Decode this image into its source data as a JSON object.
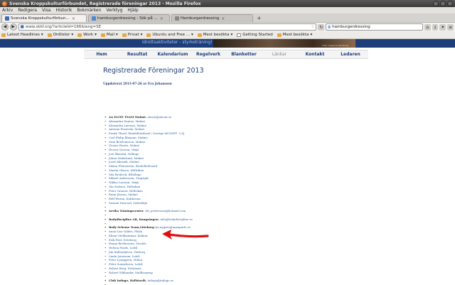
{
  "window": {
    "title": "Svenska Kroppskulturförbundet, Registrerade föreningar 2013 - Mozilla Firefox",
    "left_label": "Erik Frid"
  },
  "menubar": [
    "Arkiv",
    "Redigera",
    "Visa",
    "Historik",
    "Bokmärken",
    "Verktyg",
    "Hjälp"
  ],
  "tabs": [
    {
      "label": "Svenska Kroppskulturförbun...",
      "active": true
    },
    {
      "label": "hamburgerdressing - Sök på ...",
      "active": false
    },
    {
      "label": "Hamburgerdressing",
      "active": false
    }
  ],
  "navigation": {
    "url": "www.skkf.org/?articleId=166&lang=SE",
    "search_value": "hamburgerdressing"
  },
  "bookmarks": [
    "Latest Headlines",
    "Ordlistor",
    "Work",
    "Mail",
    "Privat",
    "Ubuntu and Free ...",
    "Mest besökta",
    "Getting Started",
    "Mest besökta"
  ],
  "site": {
    "banner_sub": "Idrottsaktiviteter - styrketräning!",
    "photo_caption": "Foto: Susanne Sandberg",
    "nav": [
      "Hem",
      "Resultat",
      "Kalendarium",
      "Regelverk",
      "Blanketter",
      "Länkar",
      "Kontakt",
      "Ledaren"
    ],
    "current_nav": "Länkar",
    "page_title": "Registrerade Föreningar 2013",
    "updated": "Uppdaterat 2013-07-26 av Eva Johansson"
  },
  "associations": [
    {
      "type": "head",
      "text": "AA ELITE TEAM Malmö.",
      "email": "aleaut@aleaut.se"
    },
    {
      "type": "person",
      "text": "Alexandra Danius, Malmö"
    },
    {
      "type": "person",
      "text": "Alexandra Larsson, Malmö"
    },
    {
      "type": "person",
      "text": "Antonia Ponevski, Malmö"
    },
    {
      "type": "person",
      "text": "Frank Thord, Rundelbordsnel / Sverige till DSFF +/3J"
    },
    {
      "type": "person",
      "text": "Carl-Philip Åhmann, Malmö"
    },
    {
      "type": "person",
      "text": "Gina Bertlomsson, Malmö"
    },
    {
      "type": "person",
      "text": "Gustav Rosén, Malmö"
    },
    {
      "type": "person",
      "text": "Hector Qusson, Växjö"
    },
    {
      "type": "person",
      "text": "Joel Åkesdal, Vellinge"
    },
    {
      "type": "person",
      "text": "Johan Söderlund, Malmö"
    },
    {
      "type": "person",
      "text": "Josef Aliozadi, Malmö"
    },
    {
      "type": "person",
      "text": "Malou Flutoström, Bredelbeltsund"
    },
    {
      "type": "person",
      "text": "Martin Olsson, Höllviken"
    },
    {
      "type": "person",
      "text": "Mia Brobeck, Båståsgo"
    },
    {
      "type": "person",
      "text": "Mikael Andersson, Trapsiplr"
    },
    {
      "type": "person",
      "text": "Niklas Larsson, Växjö"
    },
    {
      "type": "person",
      "text": "Ola Nielsen, Höllviken"
    },
    {
      "type": "person",
      "text": "Peter Gromer, Höllviken"
    },
    {
      "type": "person",
      "text": "Rami Jönsen, Malmö"
    },
    {
      "type": "person",
      "text": "Rolf Wruna, Kalskronа"
    },
    {
      "type": "person",
      "text": "Susann Dawood, Söderlälje"
    },
    {
      "type": "blank",
      "text": ""
    },
    {
      "type": "head",
      "text": "Arvika Träningscenter.",
      "email": "ckt_pettersson@hotmail.com"
    },
    {
      "type": "blank",
      "text": ""
    },
    {
      "type": "head",
      "text": "Bodydiscipline AB, Kungsängen.",
      "email": "info@bodydiscipline.se"
    },
    {
      "type": "blank",
      "text": ""
    },
    {
      "type": "head",
      "text": "Body Scheme Team,Göteborg",
      "email": "lys.nygren@annapurls.se"
    },
    {
      "type": "person",
      "text": "Anna-Lisa Valdes, Phala"
    },
    {
      "type": "person",
      "text": "Elinor Mellbammar, Kalmar"
    },
    {
      "type": "person",
      "text": "Erik Frid, Göteborg"
    },
    {
      "type": "person",
      "text": "Fanny Berthussun, Stockh..."
    },
    {
      "type": "person",
      "text": "Helena Pauds, Luleå"
    },
    {
      "type": "person",
      "text": "Jim Kallendjävsa, Varberg"
    },
    {
      "type": "person",
      "text": "Linda Jonstrom, Luleå"
    },
    {
      "type": "person",
      "text": "Peter Ljunggren, Mölna"
    },
    {
      "type": "person",
      "text": "Peter Sonnelsson, Luleå"
    },
    {
      "type": "person",
      "text": "Robert Berg, Stratarna"
    },
    {
      "type": "person",
      "text": "Robert Wiklander, Mullbosyrup"
    },
    {
      "type": "blank",
      "text": ""
    },
    {
      "type": "head",
      "text": "Club Indugo, Hallstavik.",
      "email": "indugo@indugo.se"
    },
    {
      "type": "blank",
      "text": ""
    },
    {
      "type": "head",
      "text": "CMC Fitness, Saltsjö-Boo.",
      "email": "bdecorso@cmc-fitness.com"
    },
    {
      "type": "person",
      "text": "Rosario Wegbat Lamb, Stockholm"
    }
  ],
  "colors": {
    "brand_blue": "#1e3e7a",
    "link_blue": "#2a5fa0",
    "annotation_red": "#e01010"
  }
}
